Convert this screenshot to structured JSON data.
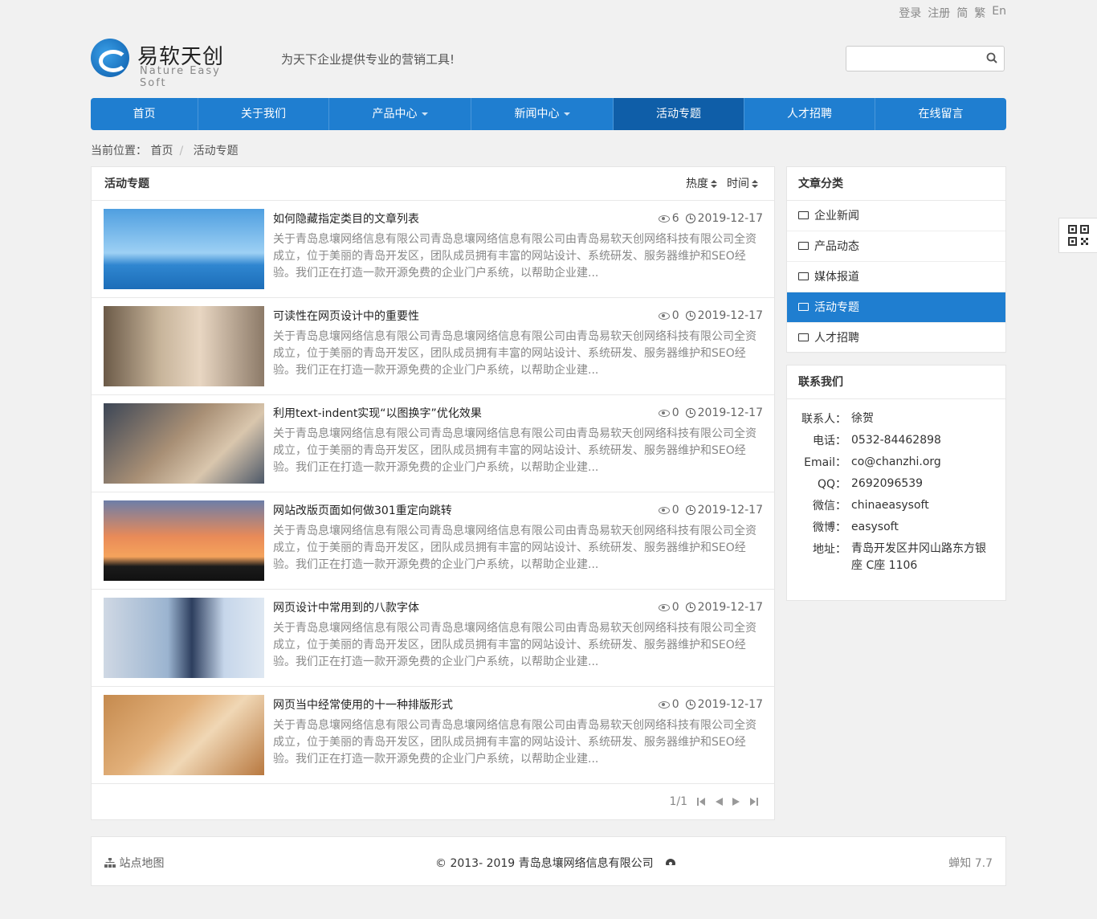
{
  "top_links": [
    "登录",
    "注册",
    "简",
    "繁",
    "En"
  ],
  "logo": {
    "cn": "易软天创",
    "en": "Nature Easy Soft"
  },
  "slogan": "为天下企业提供专业的营销工具!",
  "search": {
    "placeholder": ""
  },
  "nav": [
    {
      "label": "首页",
      "dropdown": false,
      "active": false
    },
    {
      "label": "关于我们",
      "dropdown": false,
      "active": false
    },
    {
      "label": "产品中心",
      "dropdown": true,
      "active": false
    },
    {
      "label": "新闻中心",
      "dropdown": true,
      "active": false
    },
    {
      "label": "活动专题",
      "dropdown": false,
      "active": true
    },
    {
      "label": "人才招聘",
      "dropdown": false,
      "active": false
    },
    {
      "label": "在线留言",
      "dropdown": false,
      "active": false
    }
  ],
  "breadcrumb": {
    "prefix": "当前位置：",
    "items": [
      "首页",
      "活动专题"
    ]
  },
  "list": {
    "title": "活动专题",
    "sort_hot": "热度",
    "sort_time": "时间",
    "items": [
      {
        "title": "如何隐藏指定类目的文章列表",
        "views": "6",
        "date": "2019-12-17",
        "thumb": "sailboat-sea"
      },
      {
        "title": "可读性在网页设计中的重要性",
        "views": "0",
        "date": "2019-12-17",
        "thumb": "trophy-hands"
      },
      {
        "title": "利用text-indent实现“以图换字”优化效果",
        "views": "0",
        "date": "2019-12-17",
        "thumb": "handshake-city"
      },
      {
        "title": "网站改版页面如何做301重定向跳转",
        "views": "0",
        "date": "2019-12-17",
        "thumb": "gears-sunset"
      },
      {
        "title": "网页设计中常用到的八款字体",
        "views": "0",
        "date": "2019-12-17",
        "thumb": "business-hexagons"
      },
      {
        "title": "网页当中经常使用的十一种排版形式",
        "views": "0",
        "date": "2019-12-17",
        "thumb": "puzzle-hands"
      }
    ],
    "desc_lines": [
      "关于青岛息壤网络信息有限公司青岛息壤网络信息有限公司由青岛易软天创网络科技有限公司全资",
      "成立，位于美丽的青岛开发区，团队成员拥有丰富的网站设计、系统研发、服务器维护和SEO经",
      "验。我们正在打造一款开源免费的企业门户系统，以帮助企业建..."
    ],
    "pager": "1/1"
  },
  "categories": {
    "title": "文章分类",
    "items": [
      {
        "label": "企业新闻",
        "active": false
      },
      {
        "label": "产品动态",
        "active": false
      },
      {
        "label": "媒体报道",
        "active": false
      },
      {
        "label": "活动专题",
        "active": true
      },
      {
        "label": "人才招聘",
        "active": false
      }
    ]
  },
  "contact": {
    "title": "联系我们",
    "rows": [
      {
        "k": "联系人：",
        "v": "徐贺"
      },
      {
        "k": "电话：",
        "v": "0532-84462898"
      },
      {
        "k": "Email：",
        "v": "co@chanzhi.org"
      },
      {
        "k": "QQ：",
        "v": "2692096539"
      },
      {
        "k": "微信：",
        "v": "chinaeasysoft"
      },
      {
        "k": "微博：",
        "v": "easysoft"
      },
      {
        "k": "地址：",
        "v": "青岛开发区井冈山路东方银座 C座 1106"
      }
    ]
  },
  "footer": {
    "sitemap": "站点地图",
    "copyright": "© 2013- 2019 青岛息壤网络信息有限公司",
    "powered": "蝉知 7.7"
  },
  "colors": {
    "primary": "#1f7ed0",
    "nav_active": "#0f5ea8",
    "bg": "#f1f1f1"
  }
}
